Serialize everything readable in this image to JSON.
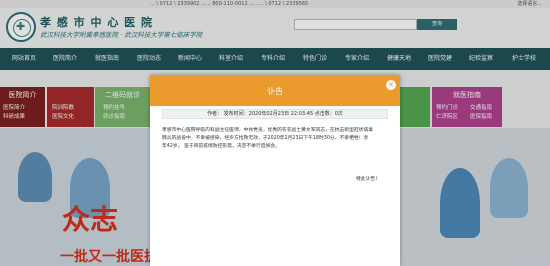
{
  "topbar": {
    "left": "... \\ 0712 \\ 2339902 ...... 800-110-0012 ......... \\ 0712 \\ 2339565",
    "right": "选择语言..."
  },
  "header": {
    "title": "孝 感 市 中 心 医 院",
    "subtitle": "武汉科技大学附属孝感医院 · 武汉科技大学第七临床学院",
    "search_button": "查询"
  },
  "nav": {
    "items": [
      "网站首页",
      "医院简介",
      "就医指南",
      "医院动态",
      "新闻中心",
      "科室介绍",
      "专科介绍",
      "特色门诊",
      "专家介绍",
      "健康天地",
      "医院党建",
      "纪检监察",
      "护士学校"
    ]
  },
  "sections": {
    "intro": {
      "heading": "医院简介",
      "links": [
        "医院简介",
        "院训院歌",
        "科研成果",
        "医院文化"
      ]
    },
    "online": {
      "heading": "二维码就诊",
      "links": [
        "预约挂号",
        "就诊指南"
      ]
    },
    "guide": {
      "heading": "就医指南",
      "links": [
        "预约门诊",
        "交通指南",
        "仁济院区",
        "医保指南"
      ]
    }
  },
  "banner": {
    "slogan_big": "众志",
    "slogan_bottom": "一批又一批医护战士前赴后继，开赴前线"
  },
  "modal": {
    "title": "讣告",
    "meta": "作者：   发布时间：2020年02月23日 22:03:45   点击数：0次",
    "body_lines": [
      "孝感市中心医院呼吸内科副主任医师，中共党员，优秀的农农战士黄文军同志，在抗击新型冠状病毒",
      "肺炎的战役中，不幸被感染，经多方抢救无效，于2020年2月23日下午18时30分，不幸牺牲！享",
      "年42岁。       鉴于目前疫情防控形势，决定不举行追悼会。"
    ],
    "signature": "特此讣告！"
  }
}
